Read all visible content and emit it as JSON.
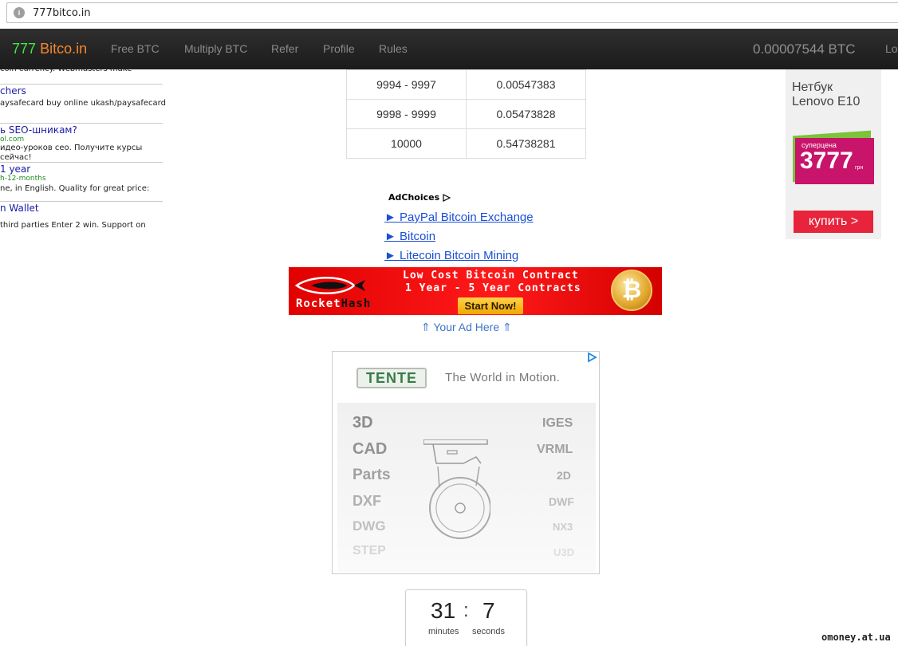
{
  "browser": {
    "url": "777bitco.in"
  },
  "nav": {
    "brand_part1": "777",
    "brand_part2": "Bitco.in",
    "items": [
      "Free BTC",
      "Multiply BTC",
      "Refer",
      "Profile",
      "Rules"
    ],
    "balance": "0.00007544 BTC",
    "login_partial": "Lo"
  },
  "left_ads": [
    {
      "desc": "coin currency. Webmasters make"
    },
    {
      "title": "chers",
      "desc": "aysafecard buy online ukash/paysafecard"
    },
    {
      "title": "ь SEO-шникам?",
      "url": "ol.com",
      "desc1": "идео-уроков сео. Получите курсы",
      "desc2": "сейчас!"
    },
    {
      "title": "1 year",
      "url": "h-12-months",
      "desc": "ne, in English. Quality for great price:"
    },
    {
      "title": "n Wallet",
      "desc": " third parties Enter 2 win. Support on"
    }
  ],
  "payout_table": [
    {
      "range": "9994 - 9997",
      "payout": "0.00547383"
    },
    {
      "range": "9998 - 9999",
      "payout": "0.05473828"
    },
    {
      "range": "10000",
      "payout": "0.54738281"
    }
  ],
  "adchoices": {
    "label": "AdChoices",
    "links": [
      "► PayPal Bitcoin Exchange",
      "► Bitcoin",
      "► Litecoin Bitcoin Mining"
    ]
  },
  "rockethash_banner": {
    "logo_part1": "Rocket",
    "logo_part2": "Hash",
    "line1": "Low Cost Bitcoin Contract",
    "line2": "1 Year - 5 Year Contracts",
    "cta": "Start Now!",
    "coin_symbol": "₿"
  },
  "your_ad_here": "⇑ Your Ad Here ⇑",
  "tente_ad": {
    "logo": "TENTE",
    "tagline": "The World in Motion.",
    "info_icon": "ad-info-icon",
    "left_formats": [
      "3D",
      "CAD",
      "Parts",
      "DXF",
      "DWG",
      "STEP"
    ],
    "right_formats": [
      "IGES",
      "VRML",
      "2D",
      "DWF",
      "NX3",
      "U3D"
    ]
  },
  "timer": {
    "minutes": "31",
    "separator": ":",
    "seconds": "7",
    "minutes_label": "minutes",
    "seconds_label": "seconds"
  },
  "netbook_ad": {
    "title_line1": "Нетбук",
    "title_line2": "Lenovo E10",
    "sticker_label": "суперцена",
    "price": "3777",
    "currency": "грн",
    "buy": "купить >"
  },
  "watermark": "omoney.at.ua",
  "colors": {
    "brand_green": "#3ee83e",
    "brand_orange": "#f5862b",
    "nav_bg": "#222222",
    "link_blue": "#1a4fd6",
    "banner_red": "#e00000"
  }
}
